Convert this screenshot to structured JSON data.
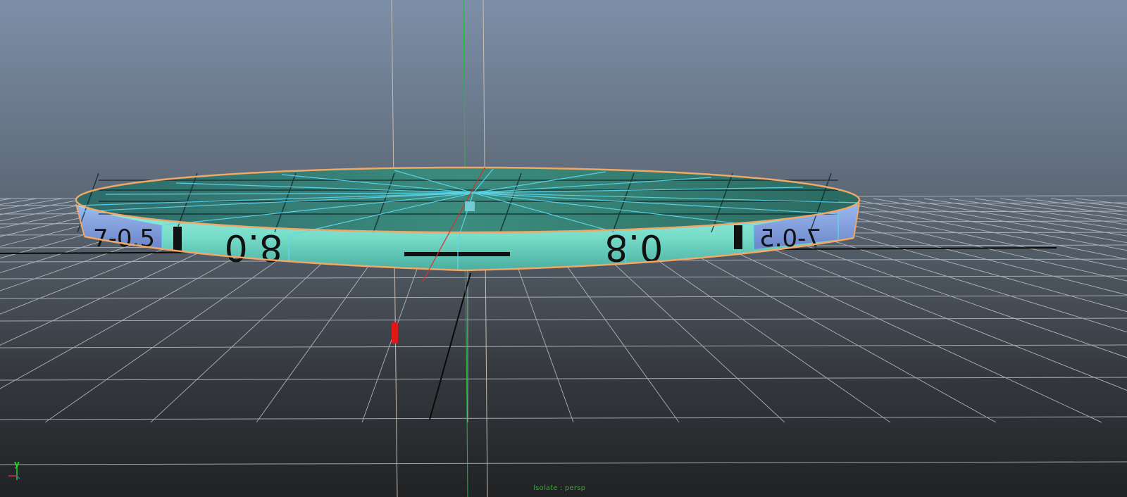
{
  "viewport": {
    "camera_label": "Isolate : persp",
    "axis_y_label": "y",
    "axis_x_label": "x"
  },
  "object": {
    "rim_labels": [
      "7-0.5",
      "0.8",
      "8.0",
      "7-0.5",
      "0.8"
    ],
    "colors": {
      "selection_outline": "#f0a868",
      "wire_highlight": "#5ed8f0",
      "face_teal": "#6fd8c8",
      "face_blue": "#7fa0e0"
    }
  },
  "icons": [
    "axis-gizmo-icon",
    "pivot-manipulator-icon"
  ],
  "colors": {
    "background_top": "#7d8fa8",
    "background_bottom": "#202224",
    "grid_line": "#b8bcc4",
    "grid_axis": "#0a0a0a",
    "camera_label": "#3aa53a"
  }
}
